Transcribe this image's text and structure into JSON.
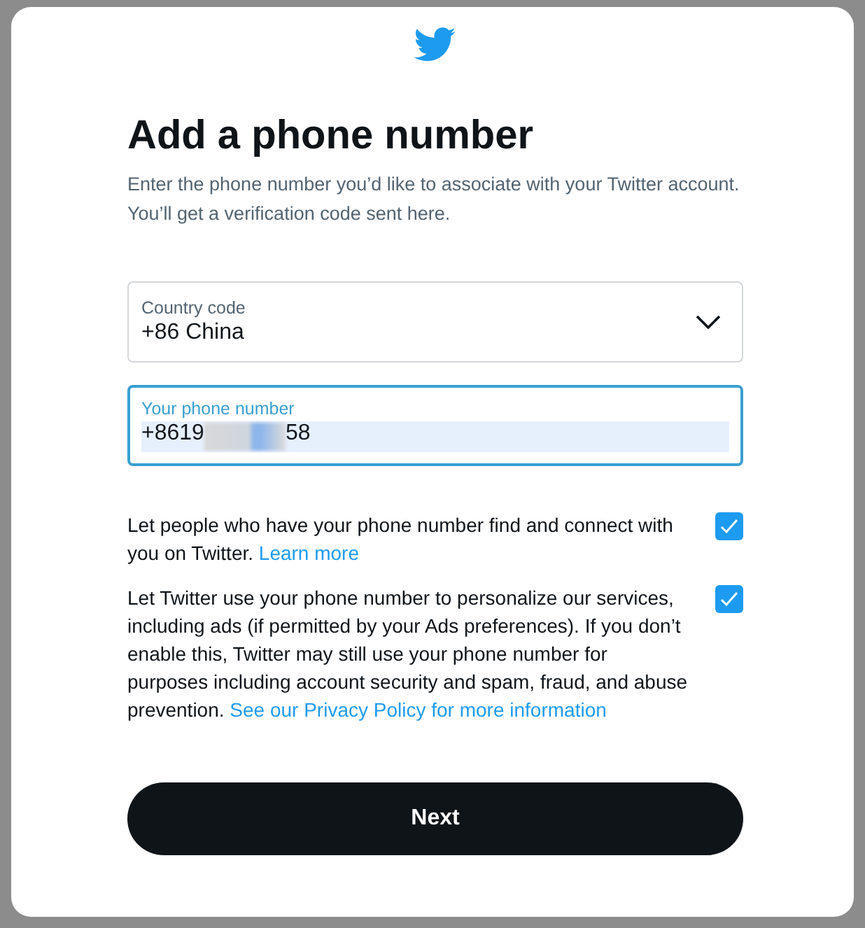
{
  "title": "Add a phone number",
  "description": "Enter the phone number you’d like to associate with your Twitter account. You’ll get a verification code sent here.",
  "country_field": {
    "label": "Country code",
    "value": "+86 China"
  },
  "phone_field": {
    "label": "Your phone number",
    "value_start": "+8619",
    "value_end": "58",
    "focused": true,
    "text_selected": true,
    "redacted": true
  },
  "options": [
    {
      "text": "Let people who have your phone number find and connect with you on Twitter.",
      "link": "Learn more",
      "checked": true
    },
    {
      "text": "Let Twitter use your phone number to personalize our services, including ads (if permitted by your Ads preferences). If you don’t enable this, Twitter may still use your phone number for purposes including account security and spam, fraud, and abuse prevention.",
      "link": "See our Privacy Policy for more information",
      "checked": true
    }
  ],
  "next_button": "Next"
}
